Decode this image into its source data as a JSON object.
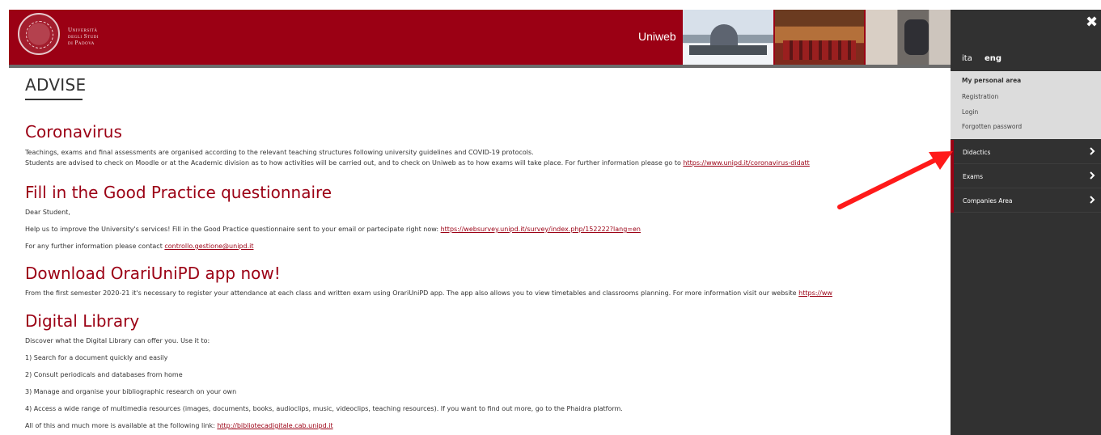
{
  "header": {
    "university_name": [
      "Università",
      "degli Studi",
      "di Padova"
    ],
    "app_label": "Uniweb"
  },
  "page": {
    "title": "ADVISE"
  },
  "sections": {
    "coronavirus": {
      "title": "Coronavirus",
      "line1": "Teachings, exams and final assessments are organised according to the relevant teaching structures following university guidelines and COVID-19 protocols.",
      "line2_prefix": "Students are advised to check on Moodle or at the Academic division as to how activities will be carried out, and to check on Uniweb as to how exams will take place. For further information please go to ",
      "line2_link": "https://www.unipd.it/coronavirus-didatt"
    },
    "questionnaire": {
      "title": "Fill in the Good Practice questionnaire",
      "greeting": "Dear Student,",
      "line1_prefix": "Help us to improve the University's services! Fill in the Good Practice questionnaire sent to your email or partecipate right now: ",
      "line1_link": "https://websurvey.unipd.it/survey/index.php/152222?lang=en",
      "line2_prefix": "For any further information please contact ",
      "line2_link": "controllo.gestione@unipd.it"
    },
    "app": {
      "title": "Download OrariUniPD app now!",
      "line1_prefix": "From the first semester 2020-21 it's necessary to register your attendance at each class and written exam using OrariUniPD app. The app also allows you to view timetables and classrooms planning. For more information visit our website ",
      "line1_link": "https://ww"
    },
    "library": {
      "title": "Digital Library",
      "intro": "Discover what the Digital Library can offer you. Use it to:",
      "items": [
        "1) Search for a document quickly and easily",
        "2) Consult periodicals and databases from home",
        "3) Manage and organise your bibliographic research on your own",
        "4) Access a wide range of multimedia resources (images, documents, books, audioclips, music, videoclips, teaching resources). If you want to find out more, go to the Phaidra platform."
      ],
      "outro_prefix": "All of this and much more is available at the following link: ",
      "outro_link": "http://bibliotecadigitale.cab.unipd.it"
    }
  },
  "drawer": {
    "close_symbol": "✖",
    "lang_ita": "ita",
    "lang_eng": "eng",
    "personal_title": "My personal area",
    "personal_links": [
      "Registration",
      "Login",
      "Forgotten password"
    ],
    "menu": [
      "Didactics",
      "Exams",
      "Companies Area"
    ]
  },
  "colors": {
    "brand_red": "#9b0014",
    "drawer_bg": "#313131",
    "annotation_arrow": "#ff1a1a"
  }
}
